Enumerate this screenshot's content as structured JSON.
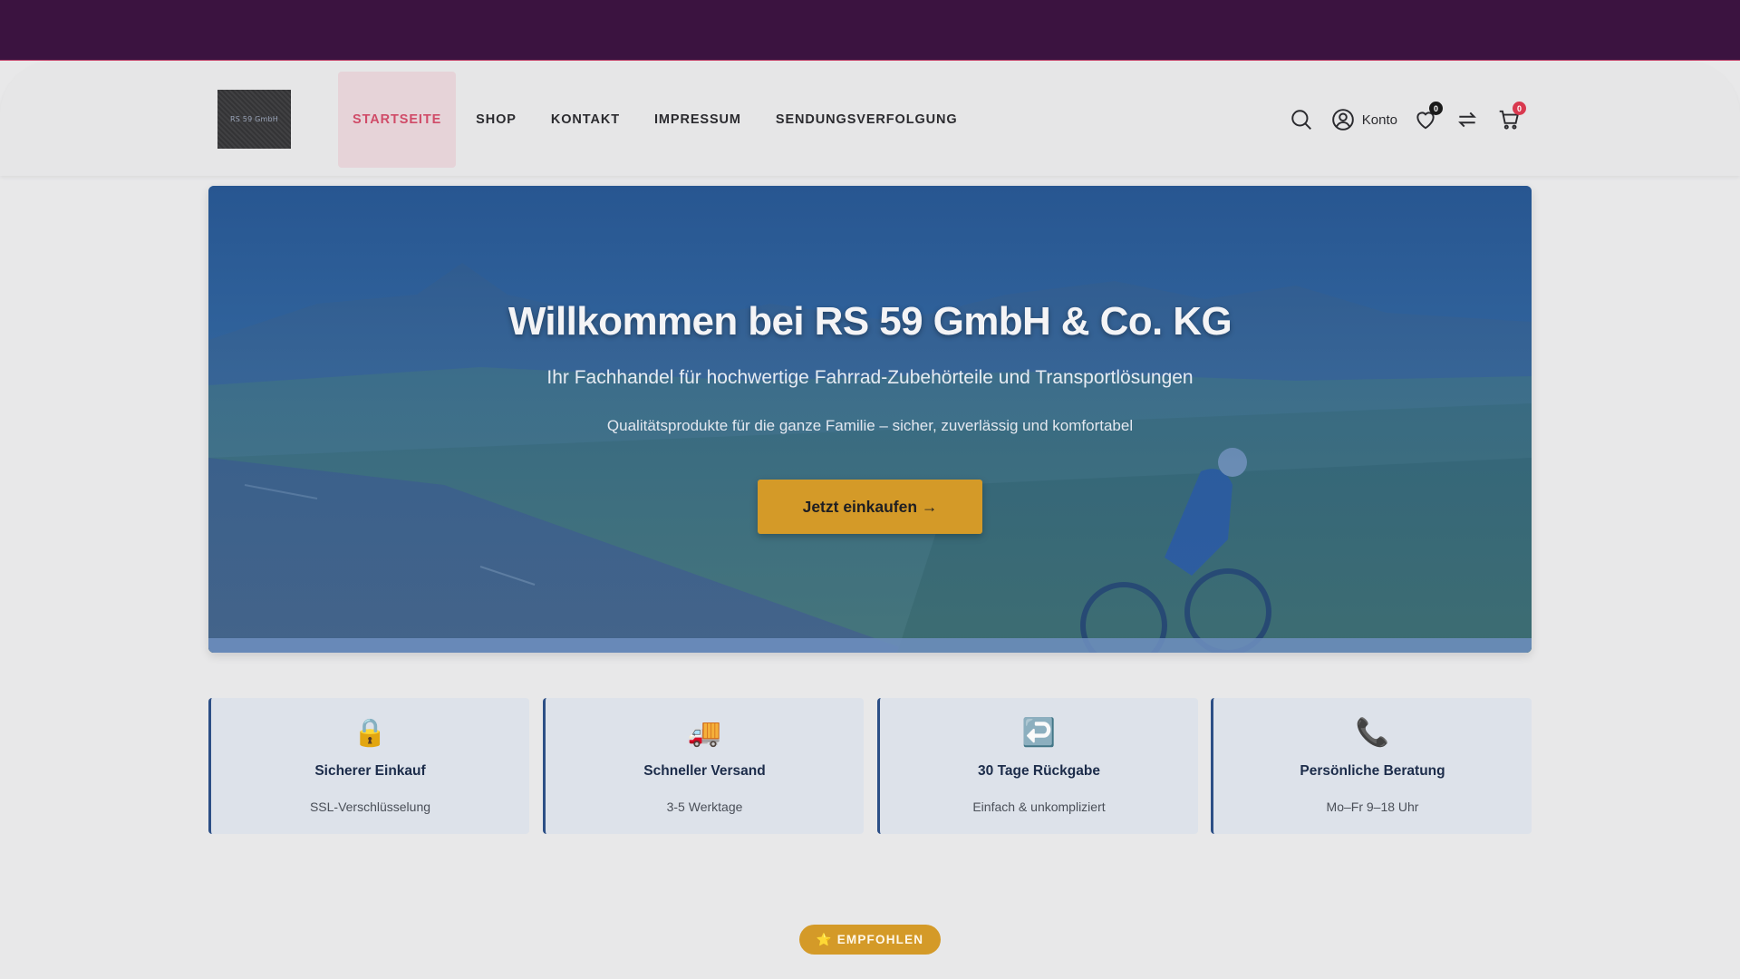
{
  "header": {
    "logo_text": "RS 59 GmbH",
    "nav": [
      {
        "label": "STARTSEITE",
        "active": true
      },
      {
        "label": "SHOP"
      },
      {
        "label": "KONTAKT"
      },
      {
        "label": "IMPRESSUM"
      },
      {
        "label": "SENDUNGSVERFOLGUNG"
      }
    ],
    "account_label": "Konto",
    "wishlist_count": "0",
    "cart_count": "0",
    "icons": [
      "search-icon",
      "user-icon",
      "heart-icon",
      "compare-icon",
      "cart-icon"
    ]
  },
  "hero": {
    "title": "Willkommen bei RS 59 GmbH & Co. KG",
    "subtitle": "Ihr Fachhandel für hochwertige Fahrrad-Zubehörteile und Transportlösungen",
    "tagline": "Qualitätsprodukte für die ganze Familie – sicher, zuverlässig und komfortabel",
    "cta_label": "Jetzt einkaufen →"
  },
  "features": [
    {
      "icon": "🔒",
      "icon_name": "lock-icon",
      "title": "Sicherer Einkauf",
      "subtitle": "SSL-Verschlüsselung"
    },
    {
      "icon": "🚚",
      "icon_name": "truck-icon",
      "title": "Schneller Versand",
      "subtitle": "3-5 Werktage"
    },
    {
      "icon": "↩️",
      "icon_name": "return-icon",
      "title": "30 Tage Rückgabe",
      "subtitle": "Einfach & unkompliziert"
    },
    {
      "icon": "📞",
      "icon_name": "phone-icon",
      "title": "Persönliche Beratung",
      "subtitle": "Mo–Fr 9–18 Uhr"
    }
  ],
  "recommended_badge": "⭐ EMPFOHLEN",
  "colors": {
    "topbar": "#3b1340",
    "accent_red": "#d04b68",
    "cta_gold": "#d49a28",
    "feature_border": "#2c4f86"
  }
}
